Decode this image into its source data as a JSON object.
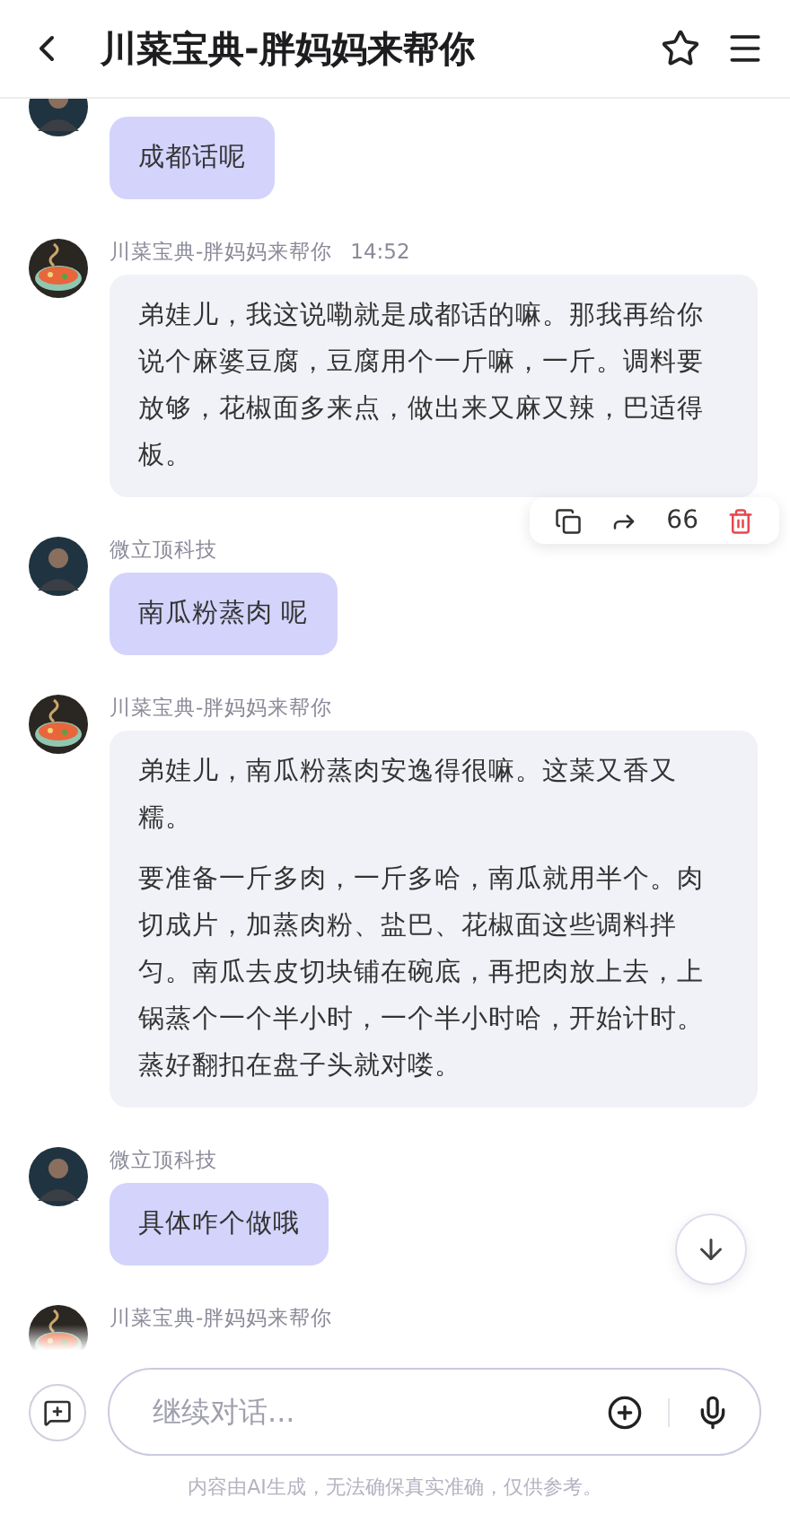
{
  "header": {
    "title": "川菜宝典-胖妈妈来帮你"
  },
  "messages": [
    {
      "kind": "user",
      "paragraphs": [
        "成都话呢"
      ]
    },
    {
      "kind": "bot",
      "sender": "川菜宝典-胖妈妈来帮你",
      "time": "14:52",
      "paragraphs": [
        "弟娃儿，我这说嘞就是成都话的嘛。那我再给你说个麻婆豆腐，豆腐用个一斤嘛，一斤。调料要放够，花椒面多来点，做出来又麻又辣，巴适得板。"
      ],
      "actions": [
        {
          "kind": "copy"
        },
        {
          "kind": "share"
        },
        {
          "kind": "quote",
          "label": "66"
        },
        {
          "kind": "delete"
        }
      ]
    },
    {
      "kind": "user",
      "sender": "微立顶科技",
      "paragraphs": [
        "南瓜粉蒸肉 呢"
      ]
    },
    {
      "kind": "bot",
      "sender": "川菜宝典-胖妈妈来帮你",
      "paragraphs": [
        "弟娃儿，南瓜粉蒸肉安逸得很嘛。这菜又香又糯。",
        "要准备一斤多肉，一斤多哈，南瓜就用半个。肉切成片，加蒸肉粉、盐巴、花椒面这些调料拌匀。南瓜去皮切块铺在碗底，再把肉放上去，上锅蒸个一个半小时，一个半小时哈，开始计时。蒸好翻扣在盘子头就对喽。"
      ]
    },
    {
      "kind": "user",
      "sender": "微立顶科技",
      "paragraphs": [
        "具体咋个做哦"
      ]
    },
    {
      "kind": "bot",
      "sender": "川菜宝典-胖妈妈来帮你"
    }
  ],
  "input": {
    "placeholder": "继续对话..."
  },
  "disclaimer": "内容由AI生成，无法确保真实准确，仅供参考。"
}
